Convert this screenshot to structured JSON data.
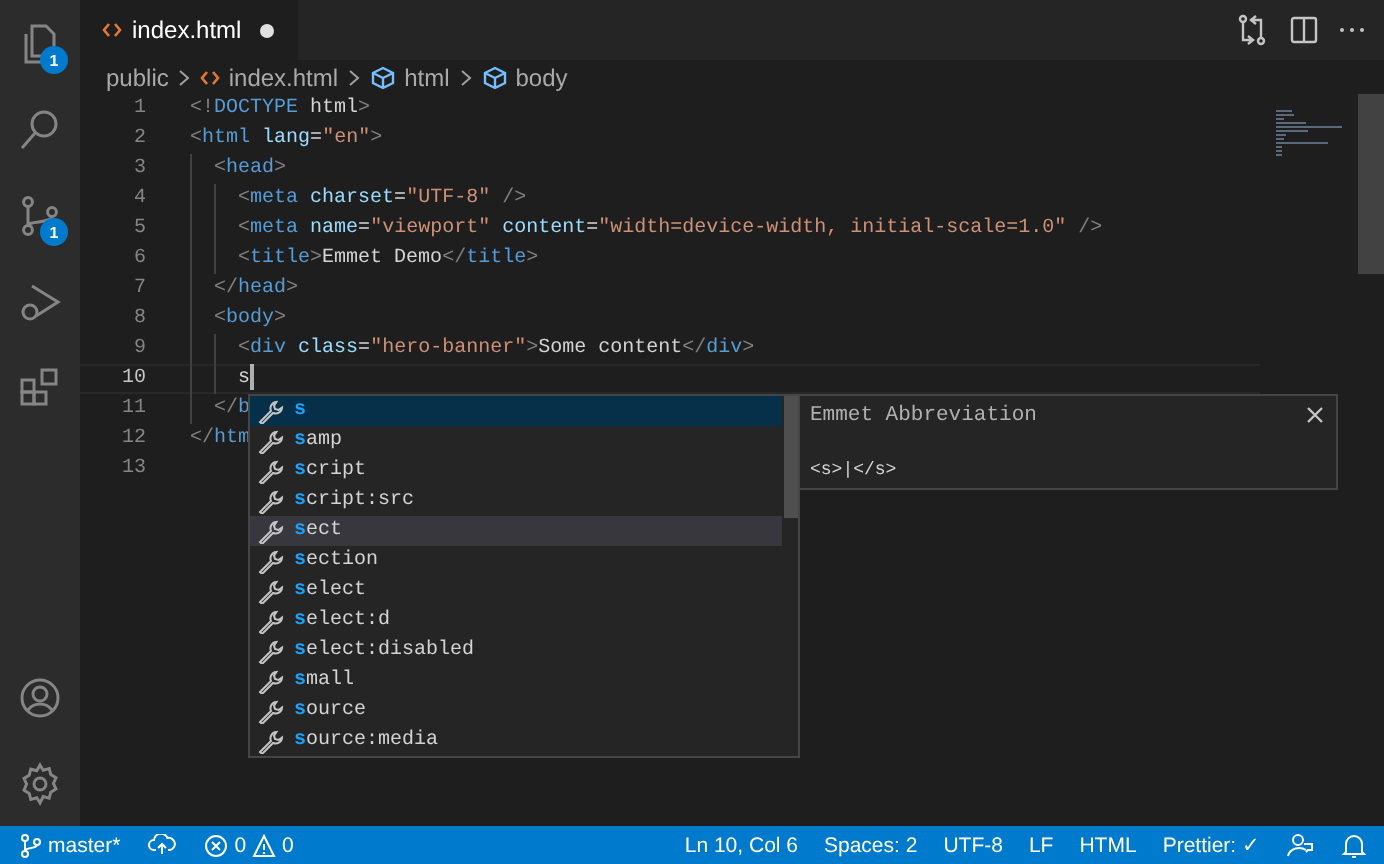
{
  "activity_bar": {
    "items": [
      {
        "kind": "files",
        "badge": "1",
        "selected": false
      },
      {
        "kind": "search",
        "selected": false
      },
      {
        "kind": "scm",
        "badge": "1",
        "selected": false
      },
      {
        "kind": "debug",
        "selected": false
      },
      {
        "kind": "extensions",
        "selected": false
      }
    ],
    "bottom": [
      {
        "kind": "account"
      },
      {
        "kind": "settings"
      }
    ]
  },
  "tab": {
    "label": "index.html",
    "modified": true
  },
  "breadcrumbs": [
    {
      "kind": "folder",
      "label": "public"
    },
    {
      "kind": "file",
      "label": "index.html"
    },
    {
      "kind": "element",
      "label": "html"
    },
    {
      "kind": "element",
      "label": "body"
    }
  ],
  "lines": [
    {
      "number": "1",
      "tokens": [
        {
          "kind": "punct",
          "text": "<!"
        },
        {
          "kind": "tag",
          "text": "DOCTYPE"
        },
        {
          "kind": "text",
          "text": " html"
        },
        {
          "kind": "punct",
          "text": ">"
        }
      ]
    },
    {
      "number": "2",
      "tokens": [
        {
          "kind": "punct",
          "text": "<"
        },
        {
          "kind": "tag",
          "text": "html"
        },
        {
          "kind": "attr",
          "text": " lang"
        },
        {
          "kind": "text",
          "text": "="
        },
        {
          "kind": "str",
          "text": "\"en\""
        },
        {
          "kind": "punct",
          "text": ">"
        }
      ]
    },
    {
      "number": "3",
      "tokens": [
        {
          "kind": "punct",
          "text": "  <"
        },
        {
          "kind": "tag",
          "text": "head"
        },
        {
          "kind": "punct",
          "text": ">"
        }
      ]
    },
    {
      "number": "4",
      "tokens": [
        {
          "kind": "punct",
          "text": "    <"
        },
        {
          "kind": "tag",
          "text": "meta"
        },
        {
          "kind": "attr",
          "text": " charset"
        },
        {
          "kind": "text",
          "text": "="
        },
        {
          "kind": "str",
          "text": "\"UTF-8\""
        },
        {
          "kind": "punct",
          "text": " />"
        }
      ]
    },
    {
      "number": "5",
      "tokens": [
        {
          "kind": "punct",
          "text": "    <"
        },
        {
          "kind": "tag",
          "text": "meta"
        },
        {
          "kind": "attr",
          "text": " name"
        },
        {
          "kind": "text",
          "text": "="
        },
        {
          "kind": "str",
          "text": "\"viewport\""
        },
        {
          "kind": "attr",
          "text": " content"
        },
        {
          "kind": "text",
          "text": "="
        },
        {
          "kind": "str",
          "text": "\"width=device-width, initial-scale=1.0\""
        },
        {
          "kind": "punct",
          "text": " />"
        }
      ]
    },
    {
      "number": "6",
      "tokens": [
        {
          "kind": "punct",
          "text": "    <"
        },
        {
          "kind": "tag",
          "text": "title"
        },
        {
          "kind": "punct",
          "text": ">"
        },
        {
          "kind": "text",
          "text": "Emmet Demo"
        },
        {
          "kind": "punct",
          "text": "</"
        },
        {
          "kind": "tag",
          "text": "title"
        },
        {
          "kind": "punct",
          "text": ">"
        }
      ]
    },
    {
      "number": "7",
      "tokens": [
        {
          "kind": "punct",
          "text": "  </"
        },
        {
          "kind": "tag",
          "text": "head"
        },
        {
          "kind": "punct",
          "text": ">"
        }
      ]
    },
    {
      "number": "8",
      "tokens": [
        {
          "kind": "punct",
          "text": "  <"
        },
        {
          "kind": "tag",
          "text": "body"
        },
        {
          "kind": "punct",
          "text": ">"
        }
      ]
    },
    {
      "number": "9",
      "tokens": [
        {
          "kind": "punct",
          "text": "    <"
        },
        {
          "kind": "tag",
          "text": "div"
        },
        {
          "kind": "attr",
          "text": " class"
        },
        {
          "kind": "text",
          "text": "="
        },
        {
          "kind": "str",
          "text": "\"hero-banner\""
        },
        {
          "kind": "punct",
          "text": ">"
        },
        {
          "kind": "text",
          "text": "Some content"
        },
        {
          "kind": "punct",
          "text": "</"
        },
        {
          "kind": "tag",
          "text": "div"
        },
        {
          "kind": "punct",
          "text": ">"
        }
      ]
    },
    {
      "number": "10",
      "current": true,
      "tokens": [
        {
          "kind": "text",
          "text": "    s"
        }
      ]
    },
    {
      "number": "11",
      "tokens": [
        {
          "kind": "punct",
          "text": "  </"
        },
        {
          "kind": "tag",
          "text": "b"
        }
      ]
    },
    {
      "number": "12",
      "tokens": [
        {
          "kind": "punct",
          "text": "</"
        },
        {
          "kind": "tag",
          "text": "htm"
        }
      ]
    },
    {
      "number": "13"
    }
  ],
  "suggest": {
    "items": [
      {
        "label": "s",
        "selected": true,
        "hovered": false
      },
      {
        "label": "samp",
        "selected": false,
        "hovered": false
      },
      {
        "label": "script",
        "selected": false,
        "hovered": false
      },
      {
        "label": "script:src",
        "selected": false,
        "hovered": false
      },
      {
        "label": "sect",
        "selected": false,
        "hovered": true
      },
      {
        "label": "section",
        "selected": false,
        "hovered": false
      },
      {
        "label": "select",
        "selected": false,
        "hovered": false
      },
      {
        "label": "select:d",
        "selected": false,
        "hovered": false
      },
      {
        "label": "select:disabled",
        "selected": false,
        "hovered": false
      },
      {
        "label": "small",
        "selected": false,
        "hovered": false
      },
      {
        "label": "source",
        "selected": false,
        "hovered": false
      },
      {
        "label": "source:media",
        "selected": false,
        "hovered": false
      }
    ],
    "details": {
      "title": "Emmet Abbreviation",
      "preview": "<s>|</s>"
    }
  },
  "status_bar": {
    "branch": "master*",
    "errors": "0",
    "warnings": "0",
    "right": [
      "Ln 10, Col 6",
      "Spaces: 2",
      "UTF-8",
      "LF",
      "HTML",
      "Prettier: ✓"
    ]
  }
}
